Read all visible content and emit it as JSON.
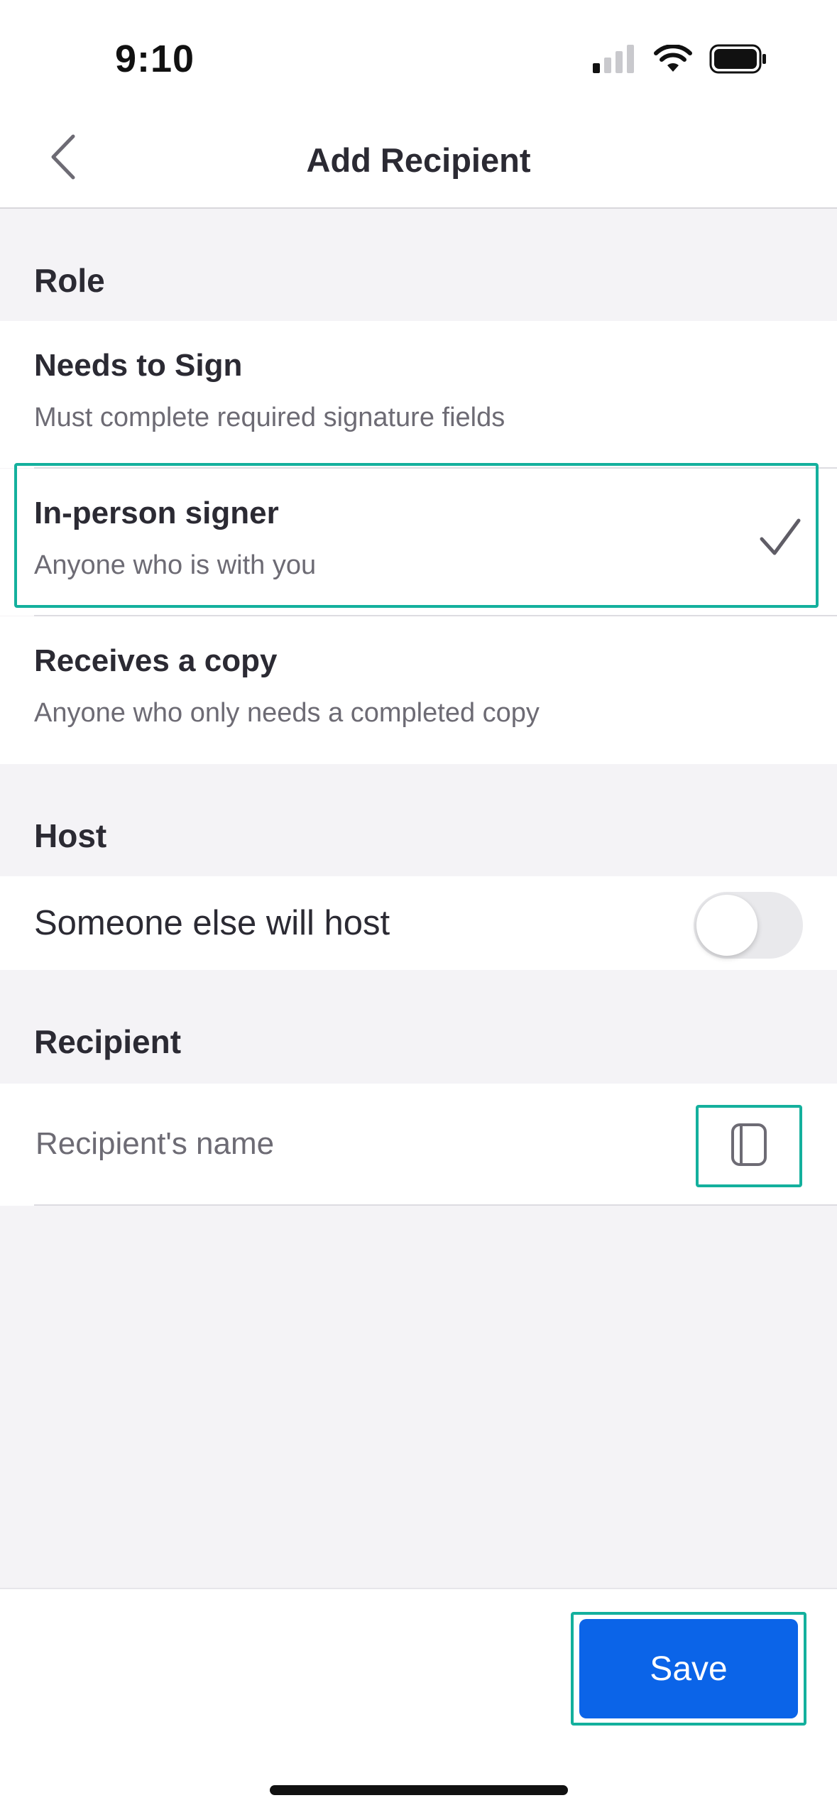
{
  "status_bar": {
    "time": "9:10",
    "icons": [
      "cellular-signal-icon",
      "wifi-icon",
      "battery-icon"
    ]
  },
  "header": {
    "title": "Add Recipient",
    "back_icon": "chevron-left-icon"
  },
  "role_section": {
    "title": "Role",
    "options": [
      {
        "title": "Needs to Sign",
        "description": "Must complete required signature fields",
        "selected": false
      },
      {
        "title": "In-person signer",
        "description": "Anyone who is with you",
        "selected": true
      },
      {
        "title": "Receives a copy",
        "description": "Anyone who only needs a completed copy",
        "selected": false
      }
    ],
    "selected_icon": "checkmark-icon"
  },
  "host_section": {
    "title": "Host",
    "toggle_label": "Someone else will host",
    "toggle_on": false
  },
  "recipient_section": {
    "title": "Recipient",
    "name_value": "",
    "name_placeholder": "Recipient's name",
    "contacts_icon": "contacts-book-icon"
  },
  "footer": {
    "save_label": "Save"
  },
  "colors": {
    "accent": "#0b64e8",
    "highlight_outline": "#14b09d",
    "background": "#f4f3f6",
    "text": "#2b2a33",
    "secondary_text": "#6d6b74"
  }
}
